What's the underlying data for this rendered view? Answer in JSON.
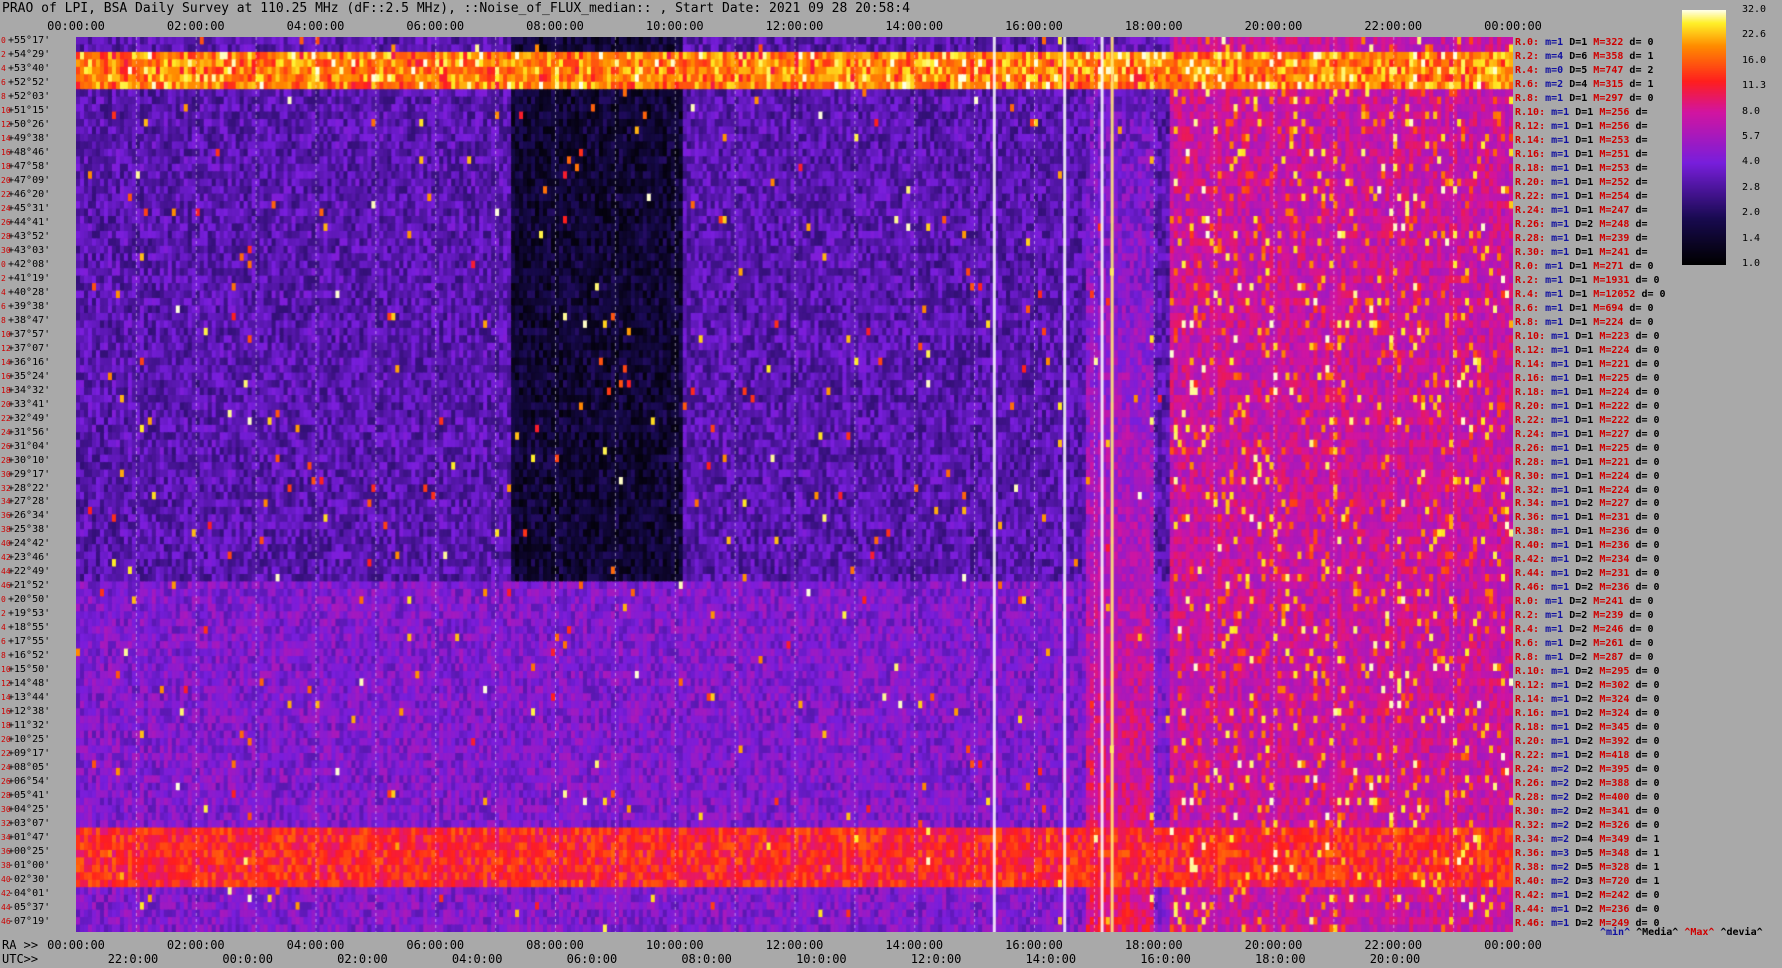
{
  "title": "PRAO of LPI, BSA Daily Survey at 110.25 MHz (dF::2.5 MHz), ::Noise_of_FLUX_median:: , Start Date: 2021 09 28 20:58:4",
  "chart_data": {
    "type": "heatmap",
    "title": "PRAO of LPI, BSA Daily Survey at 110.25 MHz (dF::2.5 MHz), ::Noise_of_FLUX_median:: , Start Date: 2021 09 28 20:58:4",
    "x_top_ticks": [
      "00:00:00",
      "02:00:00",
      "04:00:00",
      "06:00:00",
      "08:00:00",
      "10:00:00",
      "12:00:00",
      "14:00:00",
      "16:00:00",
      "18:00:00",
      "20:00:00",
      "22:00:00",
      "00:00:00"
    ],
    "ra_prefix": "RA >>",
    "ra_ticks": [
      "00:00:00",
      "02:00:00",
      "04:00:00",
      "06:00:00",
      "08:00:00",
      "10:00:00",
      "12:00:00",
      "14:00:00",
      "16:00:00",
      "18:00:00",
      "20:00:00",
      "22:00:00",
      "00:00:00"
    ],
    "utc_prefix": "UTC>>",
    "utc_ticks": [
      "22:0:00",
      "00:0:00",
      "02:0:00",
      "04:0:00",
      "06:0:00",
      "08:0:00",
      "10:0:00",
      "12:0:00",
      "14:0:00",
      "16:0:00",
      "18:0:00",
      "20:0:00"
    ],
    "dec_ticks": [
      "+55°17'",
      "+54°29'",
      "+53°40'",
      "+52°52'",
      "+52°03'",
      "+51°15'",
      "+50°26'",
      "+49°38'",
      "+48°46'",
      "+47°58'",
      "+47°09'",
      "+46°20'",
      "+45°31'",
      "+44°41'",
      "+43°52'",
      "+43°03'",
      "+42°08'",
      "+41°19'",
      "+40°28'",
      "+39°38'",
      "+38°47'",
      "+37°57'",
      "+37°07'",
      "+36°16'",
      "+35°24'",
      "+34°32'",
      "+33°41'",
      "+32°49'",
      "+31°56'",
      "+31°04'",
      "+30°10'",
      "+29°17'",
      "+28°22'",
      "+27°28'",
      "+26°34'",
      "+25°38'",
      "+24°42'",
      "+23°46'",
      "+22°49'",
      "+21°52'",
      "+20°50'",
      "+19°53'",
      "+18°55'",
      "+17°55'",
      "+16°52'",
      "+15°50'",
      "+14°48'",
      "+13°44'",
      "+12°38'",
      "+11°32'",
      "+10°25'",
      "+09°17'",
      "+08°05'",
      "+06°54'",
      "+05°41'",
      "+04°25'",
      "+03°07'",
      "+01°47'",
      "+00°25'",
      "-01°00'",
      "-02°30'",
      "-04°01'",
      "-05°37'",
      "-07°19'"
    ],
    "row_indices": [
      "0",
      "2",
      "4",
      "6",
      "8",
      "10",
      "12",
      "14",
      "16",
      "18",
      "20",
      "22",
      "24",
      "26",
      "28",
      "30",
      "0",
      "2",
      "4",
      "6",
      "8",
      "10",
      "12",
      "14",
      "16",
      "18",
      "20",
      "22",
      "24",
      "26",
      "28",
      "30",
      "32",
      "34",
      "36",
      "38",
      "40",
      "42",
      "44",
      "46",
      "0",
      "2",
      "4",
      "6",
      "8",
      "10",
      "12",
      "14",
      "16",
      "18",
      "20",
      "22",
      "24",
      "26",
      "28",
      "30",
      "32",
      "34",
      "36",
      "38",
      "40",
      "42",
      "44",
      "46"
    ],
    "stats": [
      {
        "r": "R.0:",
        "m": "m=1",
        "D": "D=1",
        "M": "M=322",
        "d": "d= 0"
      },
      {
        "r": "R.2:",
        "m": "m=4",
        "D": "D=6",
        "M": "M=358",
        "d": "d= 1"
      },
      {
        "r": "R.4:",
        "m": "m=0",
        "D": "D=5",
        "M": "M=747",
        "d": "d= 2"
      },
      {
        "r": "R.6:",
        "m": "m=2",
        "D": "D=4",
        "M": "M=315",
        "d": "d= 1"
      },
      {
        "r": "R.8:",
        "m": "m=1",
        "D": "D=1",
        "M": "M=297",
        "d": "d= 0"
      },
      {
        "r": "R.10:",
        "m": "m=1",
        "D": "D=1",
        "M": "M=256",
        "d": "d="
      },
      {
        "r": "R.12:",
        "m": "m=1",
        "D": "D=1",
        "M": "M=256",
        "d": "d="
      },
      {
        "r": "R.14:",
        "m": "m=1",
        "D": "D=1",
        "M": "M=253",
        "d": "d="
      },
      {
        "r": "R.16:",
        "m": "m=1",
        "D": "D=1",
        "M": "M=251",
        "d": "d="
      },
      {
        "r": "R.18:",
        "m": "m=1",
        "D": "D=1",
        "M": "M=253",
        "d": "d="
      },
      {
        "r": "R.20:",
        "m": "m=1",
        "D": "D=1",
        "M": "M=252",
        "d": "d="
      },
      {
        "r": "R.22:",
        "m": "m=1",
        "D": "D=1",
        "M": "M=254",
        "d": "d="
      },
      {
        "r": "R.24:",
        "m": "m=1",
        "D": "D=1",
        "M": "M=247",
        "d": "d="
      },
      {
        "r": "R.26:",
        "m": "m=1",
        "D": "D=2",
        "M": "M=248",
        "d": "d="
      },
      {
        "r": "R.28:",
        "m": "m=1",
        "D": "D=1",
        "M": "M=239",
        "d": "d="
      },
      {
        "r": "R.30:",
        "m": "m=1",
        "D": "D=1",
        "M": "M=241",
        "d": "d="
      },
      {
        "r": "R.0:",
        "m": "m=1",
        "D": "D=1",
        "M": "M=271",
        "d": "d= 0"
      },
      {
        "r": "R.2:",
        "m": "m=1",
        "D": "D=1",
        "M": "M=1931",
        "d": "d= 0"
      },
      {
        "r": "R.4:",
        "m": "m=1",
        "D": "D=1",
        "M": "M=12052",
        "d": "d= 0"
      },
      {
        "r": "R.6:",
        "m": "m=1",
        "D": "D=1",
        "M": "M=694",
        "d": "d= 0"
      },
      {
        "r": "R.8:",
        "m": "m=1",
        "D": "D=1",
        "M": "M=224",
        "d": "d= 0"
      },
      {
        "r": "R.10:",
        "m": "m=1",
        "D": "D=1",
        "M": "M=223",
        "d": "d= 0"
      },
      {
        "r": "R.12:",
        "m": "m=1",
        "D": "D=1",
        "M": "M=224",
        "d": "d= 0"
      },
      {
        "r": "R.14:",
        "m": "m=1",
        "D": "D=1",
        "M": "M=221",
        "d": "d= 0"
      },
      {
        "r": "R.16:",
        "m": "m=1",
        "D": "D=1",
        "M": "M=225",
        "d": "d= 0"
      },
      {
        "r": "R.18:",
        "m": "m=1",
        "D": "D=1",
        "M": "M=224",
        "d": "d= 0"
      },
      {
        "r": "R.20:",
        "m": "m=1",
        "D": "D=1",
        "M": "M=222",
        "d": "d= 0"
      },
      {
        "r": "R.22:",
        "m": "m=1",
        "D": "D=1",
        "M": "M=222",
        "d": "d= 0"
      },
      {
        "r": "R.24:",
        "m": "m=1",
        "D": "D=1",
        "M": "M=227",
        "d": "d= 0"
      },
      {
        "r": "R.26:",
        "m": "m=1",
        "D": "D=1",
        "M": "M=225",
        "d": "d= 0"
      },
      {
        "r": "R.28:",
        "m": "m=1",
        "D": "D=1",
        "M": "M=221",
        "d": "d= 0"
      },
      {
        "r": "R.30:",
        "m": "m=1",
        "D": "D=1",
        "M": "M=224",
        "d": "d= 0"
      },
      {
        "r": "R.32:",
        "m": "m=1",
        "D": "D=1",
        "M": "M=224",
        "d": "d= 0"
      },
      {
        "r": "R.34:",
        "m": "m=1",
        "D": "D=2",
        "M": "M=227",
        "d": "d= 0"
      },
      {
        "r": "R.36:",
        "m": "m=1",
        "D": "D=1",
        "M": "M=231",
        "d": "d= 0"
      },
      {
        "r": "R.38:",
        "m": "m=1",
        "D": "D=1",
        "M": "M=236",
        "d": "d= 0"
      },
      {
        "r": "R.40:",
        "m": "m=1",
        "D": "D=1",
        "M": "M=236",
        "d": "d= 0"
      },
      {
        "r": "R.42:",
        "m": "m=1",
        "D": "D=2",
        "M": "M=234",
        "d": "d= 0"
      },
      {
        "r": "R.44:",
        "m": "m=1",
        "D": "D=2",
        "M": "M=231",
        "d": "d= 0"
      },
      {
        "r": "R.46:",
        "m": "m=1",
        "D": "D=2",
        "M": "M=236",
        "d": "d= 0"
      },
      {
        "r": "R.0:",
        "m": "m=1",
        "D": "D=2",
        "M": "M=241",
        "d": "d= 0"
      },
      {
        "r": "R.2:",
        "m": "m=1",
        "D": "D=2",
        "M": "M=239",
        "d": "d= 0"
      },
      {
        "r": "R.4:",
        "m": "m=1",
        "D": "D=2",
        "M": "M=246",
        "d": "d= 0"
      },
      {
        "r": "R.6:",
        "m": "m=1",
        "D": "D=2",
        "M": "M=261",
        "d": "d= 0"
      },
      {
        "r": "R.8:",
        "m": "m=1",
        "D": "D=2",
        "M": "M=287",
        "d": "d= 0"
      },
      {
        "r": "R.10:",
        "m": "m=1",
        "D": "D=2",
        "M": "M=295",
        "d": "d= 0"
      },
      {
        "r": "R.12:",
        "m": "m=1",
        "D": "D=2",
        "M": "M=302",
        "d": "d= 0"
      },
      {
        "r": "R.14:",
        "m": "m=1",
        "D": "D=2",
        "M": "M=324",
        "d": "d= 0"
      },
      {
        "r": "R.16:",
        "m": "m=1",
        "D": "D=2",
        "M": "M=324",
        "d": "d= 0"
      },
      {
        "r": "R.18:",
        "m": "m=1",
        "D": "D=2",
        "M": "M=345",
        "d": "d= 0"
      },
      {
        "r": "R.20:",
        "m": "m=1",
        "D": "D=2",
        "M": "M=392",
        "d": "d= 0"
      },
      {
        "r": "R.22:",
        "m": "m=1",
        "D": "D=2",
        "M": "M=418",
        "d": "d= 0"
      },
      {
        "r": "R.24:",
        "m": "m=2",
        "D": "D=2",
        "M": "M=395",
        "d": "d= 0"
      },
      {
        "r": "R.26:",
        "m": "m=2",
        "D": "D=2",
        "M": "M=388",
        "d": "d= 0"
      },
      {
        "r": "R.28:",
        "m": "m=2",
        "D": "D=2",
        "M": "M=400",
        "d": "d= 0"
      },
      {
        "r": "R.30:",
        "m": "m=2",
        "D": "D=2",
        "M": "M=341",
        "d": "d= 0"
      },
      {
        "r": "R.32:",
        "m": "m=2",
        "D": "D=2",
        "M": "M=326",
        "d": "d= 0"
      },
      {
        "r": "R.34:",
        "m": "m=2",
        "D": "D=4",
        "M": "M=349",
        "d": "d= 1"
      },
      {
        "r": "R.36:",
        "m": "m=3",
        "D": "D=5",
        "M": "M=348",
        "d": "d= 1"
      },
      {
        "r": "R.38:",
        "m": "m=2",
        "D": "D=5",
        "M": "M=328",
        "d": "d= 1"
      },
      {
        "r": "R.40:",
        "m": "m=2",
        "D": "D=3",
        "M": "M=720",
        "d": "d= 1"
      },
      {
        "r": "R.42:",
        "m": "m=1",
        "D": "D=2",
        "M": "M=242",
        "d": "d= 0"
      },
      {
        "r": "R.44:",
        "m": "m=1",
        "D": "D=2",
        "M": "M=236",
        "d": "d= 0"
      },
      {
        "r": "R.46:",
        "m": "m=1",
        "D": "D=2",
        "M": "M=249",
        "d": "d= 0"
      }
    ],
    "legend": {
      "min": "^min^",
      "median": "^Media^",
      "max": "^Max^",
      "dev": "^devia^"
    },
    "colorbar": {
      "ticks": [
        "32.0",
        "22.6",
        "16.0",
        "11.3",
        "8.0",
        "5.7",
        "4.0",
        "2.8",
        "2.0",
        "1.4",
        "1.0"
      ],
      "range": [
        1.0,
        32.0
      ],
      "scale": "log"
    },
    "colors": {
      "bg": "#a9a9a9",
      "low": "#100a30",
      "mid": "#7a1dd8",
      "high": "#ff2020",
      "top": "#ffff80"
    }
  }
}
